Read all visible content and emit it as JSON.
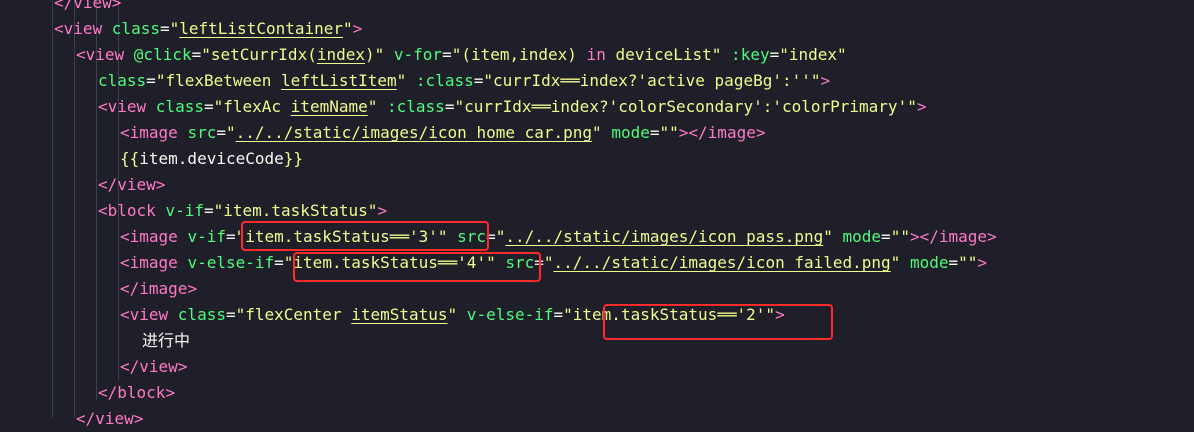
{
  "code_lines": [
    {
      "indent": 0,
      "tokens": [
        {
          "t": "</",
          "c": "tag"
        },
        {
          "t": "view",
          "c": "tag"
        },
        {
          "t": ">",
          "c": "tag"
        }
      ]
    },
    {
      "indent": 0,
      "tokens": [
        {
          "t": "<view ",
          "c": "tag"
        },
        {
          "t": "class",
          "c": "attr"
        },
        {
          "t": "=",
          "c": "text"
        },
        {
          "t": "\"",
          "c": "str"
        },
        {
          "t": "leftListContainer",
          "c": "str",
          "u": true
        },
        {
          "t": "\"",
          "c": "str"
        },
        {
          "t": ">",
          "c": "tag"
        }
      ]
    },
    {
      "indent": 1,
      "tokens": [
        {
          "t": "<view ",
          "c": "tag"
        },
        {
          "t": "@click",
          "c": "attr"
        },
        {
          "t": "=",
          "c": "text"
        },
        {
          "t": "\"setCurrIdx(",
          "c": "str"
        },
        {
          "t": "index",
          "c": "str",
          "u": true
        },
        {
          "t": ")\"",
          "c": "str"
        },
        {
          "t": " v-for",
          "c": "attr"
        },
        {
          "t": "=",
          "c": "text"
        },
        {
          "t": "\"(item,index) ",
          "c": "str"
        },
        {
          "t": "in",
          "c": "kw"
        },
        {
          "t": " deviceList\"",
          "c": "str"
        },
        {
          "t": " :key",
          "c": "attr"
        },
        {
          "t": "=",
          "c": "text"
        },
        {
          "t": "\"index\"",
          "c": "str"
        }
      ]
    },
    {
      "indent": 2,
      "tokens": [
        {
          "t": "class",
          "c": "attr"
        },
        {
          "t": "=",
          "c": "text"
        },
        {
          "t": "\"flexBetween ",
          "c": "str"
        },
        {
          "t": "leftListItem",
          "c": "str",
          "u": true
        },
        {
          "t": "\"",
          "c": "str"
        },
        {
          "t": " :class",
          "c": "attr"
        },
        {
          "t": "=",
          "c": "text"
        },
        {
          "t": "\"currIdx══index?'active pageBg':''\"",
          "c": "str"
        },
        {
          "t": ">",
          "c": "tag"
        }
      ]
    },
    {
      "indent": 2,
      "tokens": [
        {
          "t": "<view ",
          "c": "tag"
        },
        {
          "t": "class",
          "c": "attr"
        },
        {
          "t": "=",
          "c": "text"
        },
        {
          "t": "\"flexAc ",
          "c": "str"
        },
        {
          "t": "itemName",
          "c": "str",
          "u": true
        },
        {
          "t": "\"",
          "c": "str"
        },
        {
          "t": " :class",
          "c": "attr"
        },
        {
          "t": "=",
          "c": "text"
        },
        {
          "t": "\"currIdx══index?'colorSecondary':'colorPrimary'\"",
          "c": "str"
        },
        {
          "t": ">",
          "c": "tag"
        }
      ]
    },
    {
      "indent": 3,
      "tokens": [
        {
          "t": "<image ",
          "c": "tag"
        },
        {
          "t": "src",
          "c": "attr"
        },
        {
          "t": "=",
          "c": "text"
        },
        {
          "t": "\"",
          "c": "str"
        },
        {
          "t": "../../static/images/icon_home_car.png",
          "c": "str",
          "u": true
        },
        {
          "t": "\"",
          "c": "str"
        },
        {
          "t": " mode",
          "c": "attr"
        },
        {
          "t": "=",
          "c": "text"
        },
        {
          "t": "\"\"",
          "c": "str"
        },
        {
          "t": "></",
          "c": "tag"
        },
        {
          "t": "image",
          "c": "tag"
        },
        {
          "t": ">",
          "c": "tag"
        }
      ]
    },
    {
      "indent": 3,
      "tokens": [
        {
          "t": "{{",
          "c": "str"
        },
        {
          "t": "item.deviceCode",
          "c": "text"
        },
        {
          "t": "}}",
          "c": "str"
        }
      ]
    },
    {
      "indent": 2,
      "tokens": [
        {
          "t": "</",
          "c": "tag"
        },
        {
          "t": "view",
          "c": "tag"
        },
        {
          "t": ">",
          "c": "tag"
        }
      ]
    },
    {
      "indent": 2,
      "tokens": [
        {
          "t": "<block ",
          "c": "tag"
        },
        {
          "t": "v-if",
          "c": "attr"
        },
        {
          "t": "=",
          "c": "text"
        },
        {
          "t": "\"item.taskStatus\"",
          "c": "str"
        },
        {
          "t": ">",
          "c": "tag"
        }
      ]
    },
    {
      "indent": 3,
      "tokens": [
        {
          "t": "<image ",
          "c": "tag"
        },
        {
          "t": "v-if",
          "c": "attr"
        },
        {
          "t": "=",
          "c": "text"
        },
        {
          "t": "\"item.taskStatus══'3'\"",
          "c": "str"
        },
        {
          "t": " src",
          "c": "attr"
        },
        {
          "t": "=",
          "c": "text"
        },
        {
          "t": "\"",
          "c": "str"
        },
        {
          "t": "../../static/images/icon_pass.png",
          "c": "str",
          "u": true
        },
        {
          "t": "\"",
          "c": "str"
        },
        {
          "t": " mode",
          "c": "attr"
        },
        {
          "t": "=",
          "c": "text"
        },
        {
          "t": "\"\"",
          "c": "str"
        },
        {
          "t": "></",
          "c": "tag"
        },
        {
          "t": "image",
          "c": "tag"
        },
        {
          "t": ">",
          "c": "tag"
        }
      ]
    },
    {
      "indent": 3,
      "tokens": [
        {
          "t": "<image ",
          "c": "tag"
        },
        {
          "t": "v-else-if",
          "c": "attr"
        },
        {
          "t": "=",
          "c": "text"
        },
        {
          "t": "\"item.taskStatus══'4'\"",
          "c": "str"
        },
        {
          "t": " src",
          "c": "attr"
        },
        {
          "t": "=",
          "c": "text"
        },
        {
          "t": "\"",
          "c": "str"
        },
        {
          "t": "../../static/images/icon_failed.png",
          "c": "str",
          "u": true
        },
        {
          "t": "\"",
          "c": "str"
        },
        {
          "t": " mode",
          "c": "attr"
        },
        {
          "t": "=",
          "c": "text"
        },
        {
          "t": "\"\"",
          "c": "str"
        },
        {
          "t": ">",
          "c": "tag"
        }
      ]
    },
    {
      "indent": 3,
      "tokens": [
        {
          "t": "</",
          "c": "tag"
        },
        {
          "t": "image",
          "c": "tag"
        },
        {
          "t": ">",
          "c": "tag"
        }
      ]
    },
    {
      "indent": 3,
      "tokens": [
        {
          "t": "<view ",
          "c": "tag"
        },
        {
          "t": "class",
          "c": "attr"
        },
        {
          "t": "=",
          "c": "text"
        },
        {
          "t": "\"flexCenter ",
          "c": "str"
        },
        {
          "t": "itemStatus",
          "c": "str",
          "u": true
        },
        {
          "t": "\"",
          "c": "str"
        },
        {
          "t": " v-else-if",
          "c": "attr"
        },
        {
          "t": "=",
          "c": "text"
        },
        {
          "t": "\"item.taskStatus══'2'\"",
          "c": "str"
        },
        {
          "t": ">",
          "c": "tag"
        }
      ]
    },
    {
      "indent": 4,
      "tokens": [
        {
          "t": "进行中",
          "c": "text"
        }
      ]
    },
    {
      "indent": 3,
      "tokens": [
        {
          "t": "</",
          "c": "tag"
        },
        {
          "t": "view",
          "c": "tag"
        },
        {
          "t": ">",
          "c": "tag"
        }
      ]
    },
    {
      "indent": 2,
      "tokens": [
        {
          "t": "</",
          "c": "tag"
        },
        {
          "t": "block",
          "c": "tag"
        },
        {
          "t": ">",
          "c": "tag"
        }
      ]
    },
    {
      "indent": 1,
      "tokens": [
        {
          "t": "</",
          "c": "tag"
        },
        {
          "t": "view",
          "c": "tag"
        },
        {
          "t": ">",
          "c": "tag"
        }
      ]
    }
  ],
  "highlights": [
    {
      "label": "\"item.taskStatus══'3'\""
    },
    {
      "label": "\"item.taskStatus══'4'\""
    },
    {
      "label": "\"item.taskStatus══'2'\""
    }
  ],
  "colors": {
    "background": "#1e1f29",
    "tag": "#ff79c6",
    "attribute": "#50fa7b",
    "string": "#f1fa8c",
    "text": "#f8f8f2",
    "highlight_box": "#ff2a2a"
  }
}
